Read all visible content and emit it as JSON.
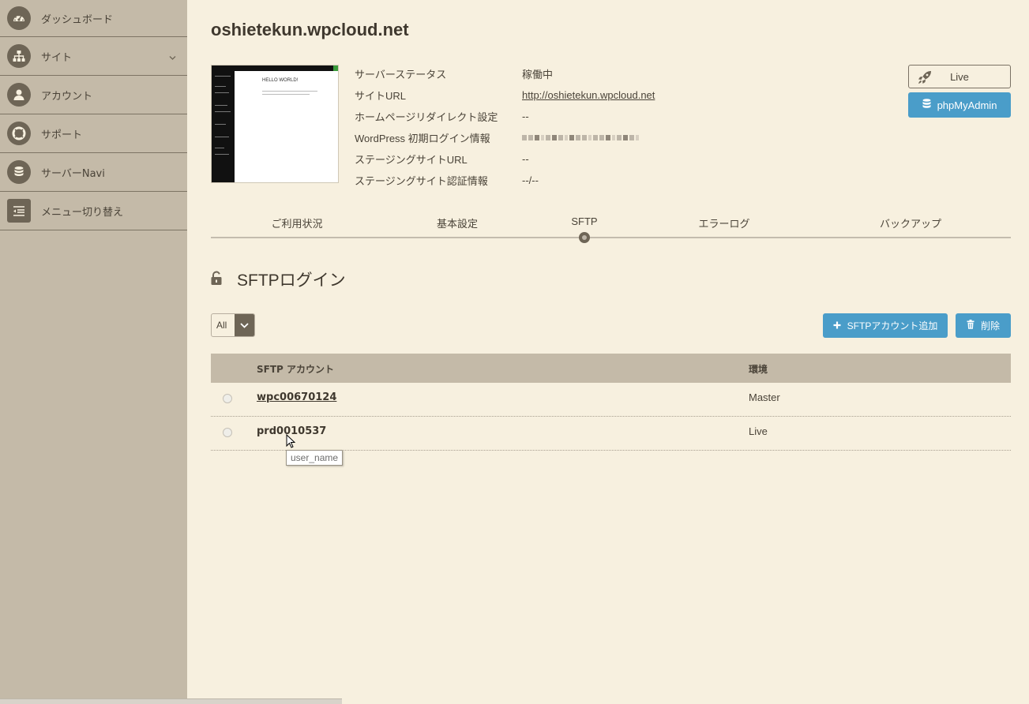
{
  "sidebar": {
    "items": [
      {
        "label": "ダッシュボード",
        "icon": "dashboard-icon"
      },
      {
        "label": "サイト",
        "icon": "sitemap-icon",
        "expandable": true
      },
      {
        "label": "アカウント",
        "icon": "user-icon"
      },
      {
        "label": "サポート",
        "icon": "lifebuoy-icon"
      },
      {
        "label": "サーバーNavi",
        "icon": "database-icon"
      },
      {
        "label": "メニュー切り替え",
        "icon": "menu-toggle-icon"
      }
    ]
  },
  "site": {
    "title": "oshietekun.wpcloud.net",
    "thumbnail": {
      "heading": "HELLO WORLD!"
    },
    "info": [
      {
        "label": "サーバーステータス",
        "value": "稼働中"
      },
      {
        "label": "サイトURL",
        "value": "http://oshietekun.wpcloud.net"
      },
      {
        "label": "ホームページリダイレクト設定",
        "value": "--"
      },
      {
        "label": "WordPress 初期ログイン情報",
        "value": ""
      },
      {
        "label": "ステージングサイトURL",
        "value": "--"
      },
      {
        "label": "ステージングサイト認証情報",
        "value": "--/--"
      }
    ],
    "buttons": {
      "live": "Live",
      "phpmyadmin": "phpMyAdmin"
    }
  },
  "tabs": {
    "items": [
      "ご利用状況",
      "基本設定",
      "SFTP",
      "エラーログ",
      "バックアップ"
    ],
    "active": "SFTP"
  },
  "sftp": {
    "title": "SFTPログイン",
    "filter": {
      "value": "All"
    },
    "add_button": "SFTPアカウント追加",
    "delete_button": "削除",
    "table": {
      "headers": {
        "account": "SFTP アカウント",
        "environment": "環境"
      },
      "rows": [
        {
          "account": "wpc00670124",
          "environment": "Master"
        },
        {
          "account": "prd0010537",
          "environment": "Live"
        }
      ]
    },
    "tooltip": "user_name"
  },
  "colors": {
    "background": "#f7f0df",
    "sidebar": "#c4baa8",
    "accent": "#4a9dc9",
    "dark": "#6e6556"
  }
}
